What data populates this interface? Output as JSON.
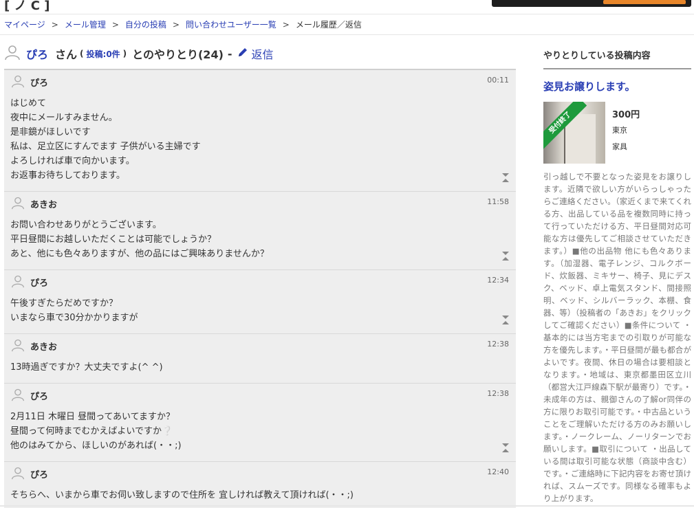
{
  "breadcrumb": {
    "items": [
      "マイページ",
      "メール管理",
      "自分の投稿",
      "問い合わせユーザー一覧"
    ],
    "current": "メール履歴／返信",
    "separator": ">"
  },
  "thread": {
    "partner_name": "ぴろ",
    "san": "さん",
    "paren_open": "(",
    "post_count": "投稿:0件",
    "paren_close": ")",
    "exchange_label": "とのやりとり(24)",
    "dash": "-",
    "reply_label": "返信"
  },
  "messages": [
    {
      "sender": "ぴろ",
      "time": "00:11",
      "lines": [
        "はじめて",
        "夜中にメールすみません。",
        "是非鏡がほしいです",
        "私は、足立区にすんでます 子供がいる主婦です",
        "よろしければ車で向かいます。",
        "お返事お待ちしております。"
      ],
      "toggle": true
    },
    {
      "sender": "あきお",
      "time": "11:58",
      "lines": [
        "お問い合わせありがとうございます。",
        "平日昼間にお越しいただくことは可能でしょうか？",
        "あと、他にも色々ありますが、他の品にはご興味ありませんか？"
      ],
      "toggle": true
    },
    {
      "sender": "ぴろ",
      "time": "12:34",
      "lines": [
        "午後すぎたらだめですか？",
        "いまなら車で30分かかりますが"
      ],
      "toggle": true
    },
    {
      "sender": "あきお",
      "time": "12:38",
      "lines": [
        "13時過ぎですか？大丈夫ですよ(^ ^)"
      ],
      "toggle": false
    },
    {
      "sender": "ぴろ",
      "time": "12:38",
      "lines": [
        "2月11日 木曜日 昼間ってあいてますか？",
        "昼間って何時までむかえばよいですか❔",
        "他のはみてから、ほしいのがあれば(・・;)"
      ],
      "toggle": true
    },
    {
      "sender": "ぴろ",
      "time": "12:40",
      "lines": [
        "そちらへ、いまから車でお伺い致しますので住所を 宜しければ教えて頂ければ(・・;)"
      ],
      "toggle": false
    }
  ],
  "sidebar": {
    "title": "やりとりしている投稿内容",
    "post_title": "姿見お譲りします。",
    "price": "300円",
    "location": "東京",
    "category": "家具",
    "thumb_badge": "受付終了",
    "description": "引っ越しで不要となった姿見をお譲りします。近隣で欲しい方がいらっしゃったらご連絡ください。（家近くまで来てくれる方、出品している品を複数同時に持って行っていただける方、平日昼間対応可能な方は優先してご相談させていただきます。）■他の出品物 他にも色々あります。（加湿器、電子レンジ、コルクボード、炊飯器、ミキサー、椅子、見にデスク、ベッド、卓上電気スタンド、間接照明、ベッド、シルバーラック、本棚、食器、等）（投稿者の「あきお」をクリックしてご確認ください）■条件について ・基本的には当方宅までの引取りが可能な方を優先します。・平日昼間が最も都合がよいです。夜間、休日の場合は要相談となります。・地域は、東京都墨田区立川（都営大江戸線森下駅が最寄り）です。・未成年の方は、親御さんの了解or同伴の方に限りお取引可能です。・中古品ということをご理解いただける方のみお願いします。・ノークレーム、ノーリターンでお願いします。■取引について ・出品している間は取引可能な状態（商談中含む）です。・ご連絡時に下記内容をお寄せ頂ければ、スムーズです。同様なる確率もより上がります。"
  },
  "colors": {
    "link": "#2a3fb4",
    "message_bg": "#eeeeee",
    "badge_green": "#1e9a3c"
  }
}
